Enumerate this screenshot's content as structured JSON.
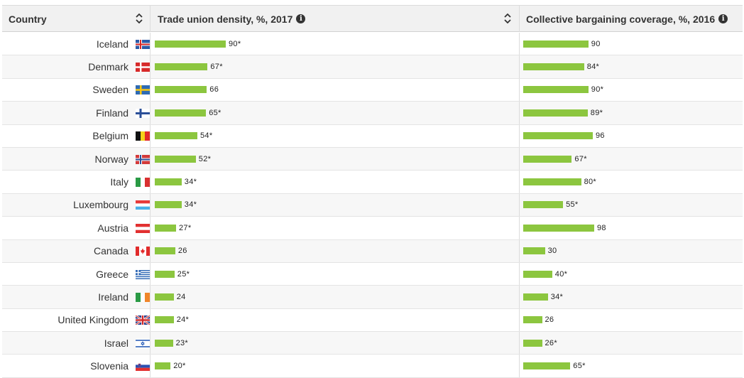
{
  "header": {
    "country": "Country",
    "union": "Trade union density, %, 2017",
    "bargaining": "Collective bargaining coverage, %, 2016"
  },
  "colors": {
    "bar": "#8cc63f"
  },
  "rows": [
    {
      "country": "Iceland",
      "flag": "iceland-flag-icon",
      "union": 90,
      "union_label": "90*",
      "bargain": 90,
      "bargain_label": "90"
    },
    {
      "country": "Denmark",
      "flag": "denmark-flag-icon",
      "union": 67,
      "union_label": "67*",
      "bargain": 84,
      "bargain_label": "84*"
    },
    {
      "country": "Sweden",
      "flag": "sweden-flag-icon",
      "union": 66,
      "union_label": "66",
      "bargain": 90,
      "bargain_label": "90*"
    },
    {
      "country": "Finland",
      "flag": "finland-flag-icon",
      "union": 65,
      "union_label": "65*",
      "bargain": 89,
      "bargain_label": "89*"
    },
    {
      "country": "Belgium",
      "flag": "belgium-flag-icon",
      "union": 54,
      "union_label": "54*",
      "bargain": 96,
      "bargain_label": "96"
    },
    {
      "country": "Norway",
      "flag": "norway-flag-icon",
      "union": 52,
      "union_label": "52*",
      "bargain": 67,
      "bargain_label": "67*"
    },
    {
      "country": "Italy",
      "flag": "italy-flag-icon",
      "union": 34,
      "union_label": "34*",
      "bargain": 80,
      "bargain_label": "80*"
    },
    {
      "country": "Luxembourg",
      "flag": "luxembourg-flag-icon",
      "union": 34,
      "union_label": "34*",
      "bargain": 55,
      "bargain_label": "55*"
    },
    {
      "country": "Austria",
      "flag": "austria-flag-icon",
      "union": 27,
      "union_label": "27*",
      "bargain": 98,
      "bargain_label": "98"
    },
    {
      "country": "Canada",
      "flag": "canada-flag-icon",
      "union": 26,
      "union_label": "26",
      "bargain": 30,
      "bargain_label": "30"
    },
    {
      "country": "Greece",
      "flag": "greece-flag-icon",
      "union": 25,
      "union_label": "25*",
      "bargain": 40,
      "bargain_label": "40*"
    },
    {
      "country": "Ireland",
      "flag": "ireland-flag-icon",
      "union": 24,
      "union_label": "24",
      "bargain": 34,
      "bargain_label": "34*"
    },
    {
      "country": "United Kingdom",
      "flag": "uk-flag-icon",
      "union": 24,
      "union_label": "24*",
      "bargain": 26,
      "bargain_label": "26"
    },
    {
      "country": "Israel",
      "flag": "israel-flag-icon",
      "union": 23,
      "union_label": "23*",
      "bargain": 26,
      "bargain_label": "26*"
    },
    {
      "country": "Slovenia",
      "flag": "slovenia-flag-icon",
      "union": 20,
      "union_label": "20*",
      "bargain": 65,
      "bargain_label": "65*"
    }
  ]
}
